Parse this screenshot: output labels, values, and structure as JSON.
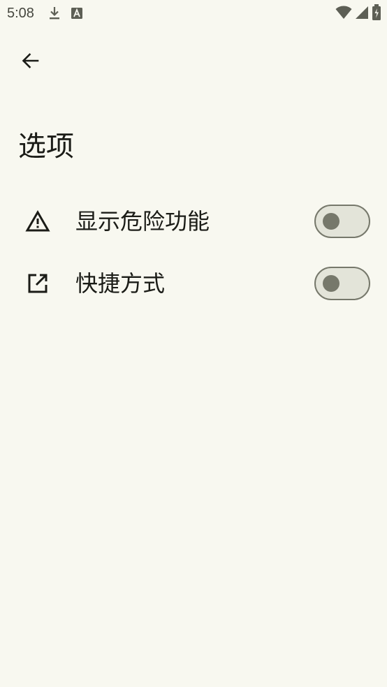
{
  "status_bar": {
    "time": "5:08",
    "icons_left": [
      "download-icon",
      "font-a-icon"
    ],
    "icons_right": [
      "wifi-icon",
      "signal-icon",
      "battery-icon"
    ]
  },
  "header": {
    "back_icon": "arrow-back-icon",
    "title": "选项"
  },
  "settings": {
    "items": [
      {
        "label": "显示危险功能",
        "icon": "warning-icon",
        "enabled": false
      },
      {
        "label": "快捷方式",
        "icon": "open-in-new-icon",
        "enabled": false
      }
    ]
  },
  "colors": {
    "background": "#f8f8f0",
    "text": "#1b1c17",
    "switch_track": "#e3e4d9",
    "switch_outline": "#76786b"
  }
}
